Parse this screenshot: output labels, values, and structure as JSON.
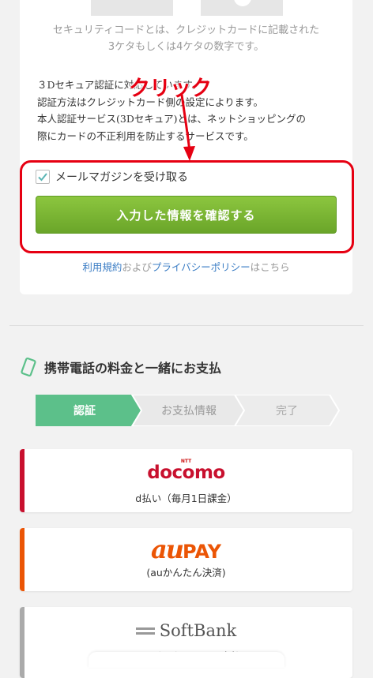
{
  "security_note": {
    "line1": "セキュリティコードとは、クレジットカードに記載された",
    "line2": "3ケタもしくは4ケタの数字です。"
  },
  "secure3d": {
    "line1": "３Dセキュア認証に対応しています。",
    "line2": "認証方法はクレジットカード側の設定によります。",
    "line3": "本人認証サービス(3Dセキュア)とは、ネットショッピングの",
    "line4": "際にカードの不正利用を防止するサービスです。"
  },
  "annotation": {
    "label": "クリック",
    "color": "#e60012"
  },
  "newsletter": {
    "label": "メールマガジンを受け取る",
    "checked": true
  },
  "confirm_button": {
    "label": "入力した情報を確認する",
    "color": "#7ab539"
  },
  "terms": {
    "terms_link": "利用規約",
    "and": "および",
    "privacy_link": "プライバシーポリシー",
    "suffix": "はこちら"
  },
  "carrier_section": {
    "title": "携帯電話の料金と一緒にお支払",
    "icon": "smartphone-icon"
  },
  "steps": [
    {
      "label": "認証",
      "active": true
    },
    {
      "label": "お支払情報",
      "active": false
    },
    {
      "label": "完了",
      "active": false
    }
  ],
  "payment_options": {
    "docomo": {
      "ntt": "NTT",
      "logo": "docomo",
      "sub": "d払い（毎月1日課金）",
      "color": "#c8102e"
    },
    "au": {
      "logo_au": "au",
      "logo_pay": "PAY",
      "sub": "(auかんたん決済)",
      "color": "#eb5505"
    },
    "softbank": {
      "logo": "SoftBank",
      "sub": "ソフトバンクまとめて支払い",
      "color": "#aaaaaa"
    }
  }
}
